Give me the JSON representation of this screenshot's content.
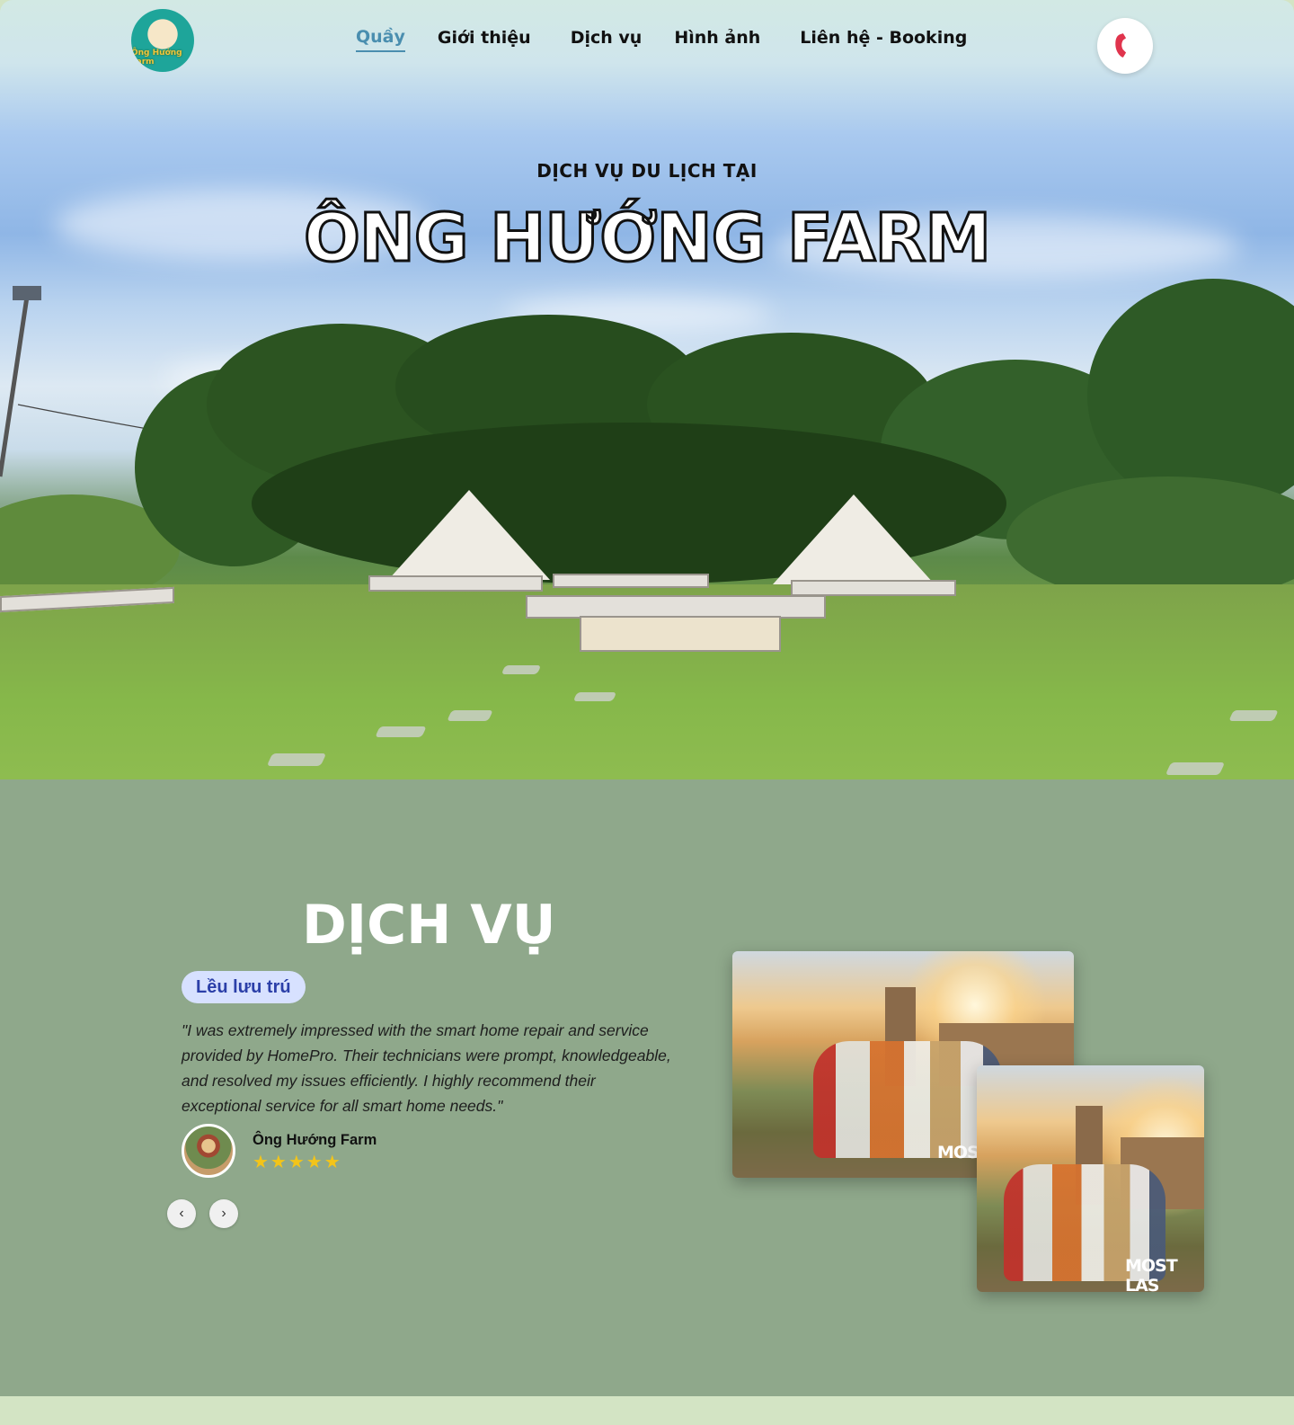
{
  "nav": {
    "logo_text": "Ông Hướng Farm",
    "items": [
      {
        "label": "Quầy",
        "active": true
      },
      {
        "label": "Giới thiệu"
      },
      {
        "label": "Dịch vụ"
      },
      {
        "label": "Hình ảnh"
      },
      {
        "label": "Liên hệ - Booking"
      }
    ],
    "phone_icon": "phone-icon",
    "phone_icon_color": "#e0344d"
  },
  "hero": {
    "subtitle": "DỊCH VỤ DU LỊCH TẠI",
    "title": "ÔNG HƯỚNG FARM"
  },
  "services": {
    "title": "DỊCH VỤ",
    "tag": "Lều lưu trú",
    "quote": "\"I was extremely impressed with the smart home repair and service provided by HomePro. Their technicians were prompt, knowledgeable, and resolved my issues efficiently. I highly recommend their exceptional service for all smart home needs.\"",
    "author": "Ông Hướng Farm",
    "stars": "★★★★★",
    "rating": 5,
    "prev_icon": "‹",
    "next_icon": "›",
    "photo_mark_main": "MOST",
    "photo_mark_secondary_a": "MOST LAS",
    "background": "#8fa88b",
    "tag_bg": "#d7e1ff",
    "star_color": "#f3c419"
  }
}
